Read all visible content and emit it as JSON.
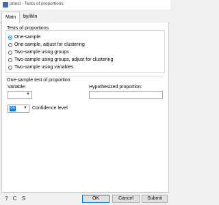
{
  "window": {
    "title": "prtest - Tests of proportions"
  },
  "tabs": [
    {
      "label": "Main"
    },
    {
      "label": "by/if/in"
    }
  ],
  "tests": {
    "group_label": "Tests of proportions",
    "options": [
      {
        "label": "One-sample",
        "selected": true
      },
      {
        "label": "One-sample, adjust for clustering",
        "selected": false
      },
      {
        "label": "Two-sample using groups",
        "selected": false
      },
      {
        "label": "Two-sample using groups, adjust for clustering",
        "selected": false
      },
      {
        "label": "Two-sample using variables",
        "selected": false
      }
    ]
  },
  "one_sample": {
    "section_label": "One-sample test of proportion",
    "variable_label": "Variable:",
    "variable_value": "",
    "hypothesized_label": "Hypothesized proportion:",
    "hypothesized_value": "",
    "confidence_value": "95",
    "confidence_label": "Confidence level"
  },
  "footer": {
    "help_icon": "?",
    "copy_icon": "C",
    "submit_icon": "S",
    "ok_label": "OK",
    "cancel_label": "Cancel",
    "submit_label": "Submit"
  },
  "colors": {
    "accent": "#0078d7"
  }
}
